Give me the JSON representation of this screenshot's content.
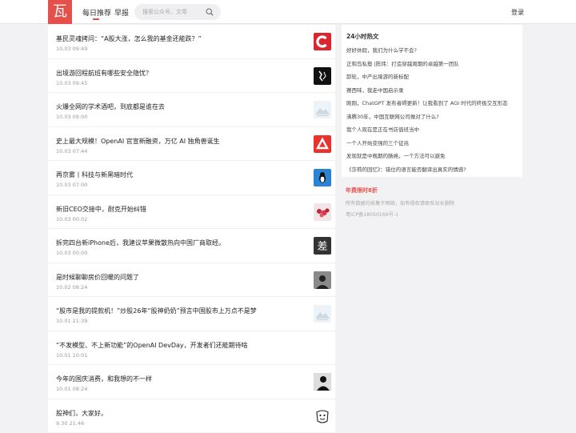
{
  "header": {
    "logo_char": "瓦",
    "nav": {
      "daily": "每日推荐",
      "morning": "早报"
    },
    "search_placeholder": "搜索公众号、文章",
    "login": "登录",
    "accent": "#e5514a"
  },
  "feed": [
    {
      "title": "基民灵魂拷问：“A股大涨，怎么我的基金还能跌？”",
      "time": "10.03 09:49",
      "thumb": "c-logo-icon"
    },
    {
      "title": "出境游回程航班有哪些安全隐忧？",
      "time": "10.03 09:45",
      "thumb": "calligraphy-avatar"
    },
    {
      "title": "火爆全网的学术酒吧，到底都是谁在去",
      "time": "10.03 09:00",
      "thumb": "landscape-placeholder"
    },
    {
      "title": "史上最大规模！OpenAI 官宣新融资，万亿 AI 独角兽诞生",
      "time": "10.03 07:44",
      "thumb": "red-triangle-logo"
    },
    {
      "title": "再京雾丨科技与新黑暗时代",
      "time": "10.03 07:00",
      "thumb": "penguin-avatar"
    },
    {
      "title": "新旧CEO交接中，耐克开始纠错",
      "time": "10.03 00:02",
      "thumb": "roses-thumbnail"
    },
    {
      "title": "拆完四台新iPhone后，我建议苹果微散热向中国厂商取经。",
      "time": "10.03 00:00",
      "thumb": "cha-logo"
    },
    {
      "title": "是时候聊聊房价回暖的问题了",
      "time": "10.02 08:24",
      "thumb": "portrait-thumbnail"
    },
    {
      "title": "“股市是我的提款机！”炒股26年“股神奶奶”预言中国股市上万点不是梦",
      "time": "10.01 21:39",
      "thumb": "landscape-placeholder"
    },
    {
      "title": "“不发模型、不上新功能”的OpenAI DevDay，开发者们还能期待啥",
      "time": "10.01 10:01",
      "thumb": ""
    },
    {
      "title": "今年的国庆消费，和我想的不一样",
      "time": "10.01 08:24",
      "thumb": "bw-portrait-thumbnail"
    },
    {
      "title": "股神们，大家好。",
      "time": "9.30 21:46",
      "thumb": "cartoon-face-avatar"
    }
  ],
  "sidebar": {
    "title": "24小时热文",
    "items": [
      "好好休假，我们为什么学不会?",
      "正和岛私塾 |陈玮：打造穿越周期的卓越第一团队",
      "卸轮，中产出境游的新标配",
      "赛西味，我走中国启示录",
      "刚刚，ChatGPT 发布者碍更新！让我看到了 AGI 时代的终极交互形态",
      "沸腾30年，中国互联网公司做对了什么?",
      "我个人现在是正在书店值班当中",
      "一个人开始变强的三个征兆",
      "发现就是中晚期的肠癌，一个方法可以避免",
      "《莎莉的回忆》：错位的语言能否翻译出真实的情感?"
    ]
  },
  "promo": "年费限时8折",
  "footer": {
    "disclaimer": "所有数据均采集于网络，如有侵权请联系站长删除",
    "icp": "粤ICP备18050166号-1"
  }
}
